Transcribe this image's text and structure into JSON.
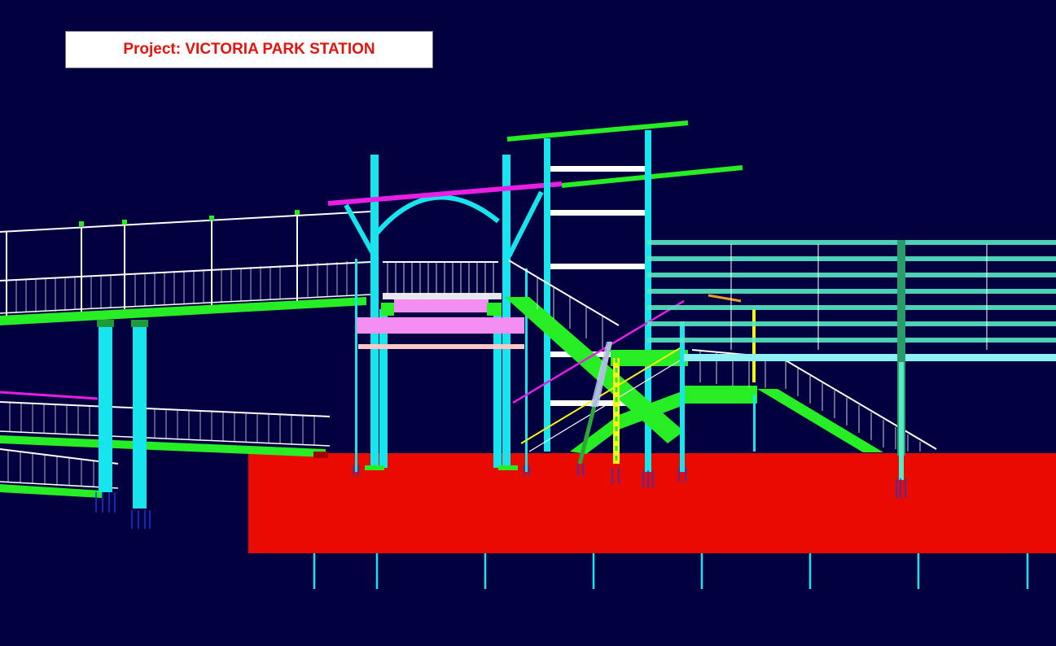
{
  "title": {
    "label": "Project: VICTORIA PARK STATION"
  },
  "colors": {
    "background": "#03003f",
    "platform": "#ea0b00",
    "steel_column": "#17e5ee",
    "deck_beam": "#27ee24",
    "handrail": "#ffffff",
    "canopy_beam": "#e81ee3",
    "landing_slab": "#f48ff2",
    "wall_cladding": "#58e8c4",
    "accent_yellow": "#f5f51a",
    "title_text": "#e8120c"
  }
}
